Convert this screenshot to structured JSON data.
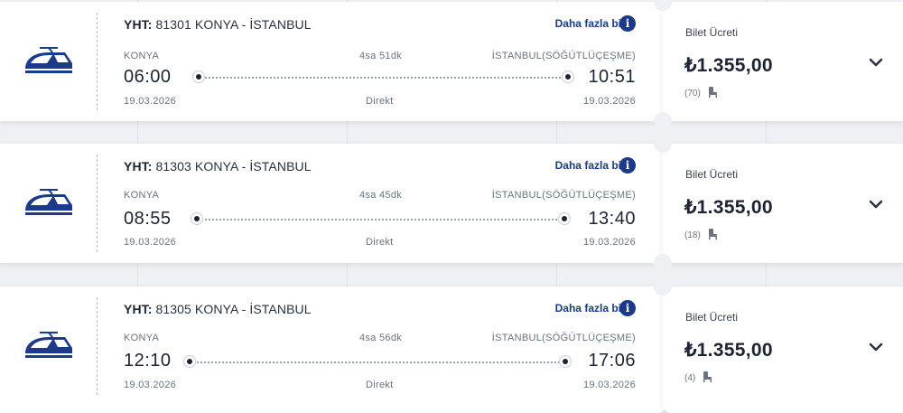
{
  "trips": [
    {
      "title_code": "YHT:",
      "title_route": "81301 KONYA - İSTANBUL",
      "info_link": "Daha fazla bilgi",
      "from_station": "KONYA",
      "to_station": "İSTANBUL(SÖĞÜTLÜÇEŞME)",
      "duration": "4sa 51dk",
      "depart_time": "06:00",
      "arrive_time": "10:51",
      "depart_date": "19.03.2026",
      "arrive_date": "19.03.2026",
      "connection": "Direkt",
      "price_label": "Bilet Ücreti",
      "price": "₺1.355,00",
      "seats": "(70)"
    },
    {
      "title_code": "YHT:",
      "title_route": "81303 KONYA - İSTANBUL",
      "info_link": "Daha fazla bilgi",
      "from_station": "KONYA",
      "to_station": "İSTANBUL(SÖĞÜTLÜÇEŞME)",
      "duration": "4sa 45dk",
      "depart_time": "08:55",
      "arrive_time": "13:40",
      "depart_date": "19.03.2026",
      "arrive_date": "19.03.2026",
      "connection": "Direkt",
      "price_label": "Bilet Ücreti",
      "price": "₺1.355,00",
      "seats": "(18)"
    },
    {
      "title_code": "YHT:",
      "title_route": "81305 KONYA - İSTANBUL",
      "info_link": "Daha fazla bilgi",
      "from_station": "KONYA",
      "to_station": "İSTANBUL(SÖĞÜTLÜÇEŞME)",
      "duration": "4sa 56dk",
      "depart_time": "12:10",
      "arrive_time": "17:06",
      "depart_date": "19.03.2026",
      "arrive_date": "19.03.2026",
      "connection": "Direkt",
      "price_label": "Bilet Ücreti",
      "price": "₺1.355,00",
      "seats": "(4)"
    }
  ],
  "icons": {
    "train": "train-icon",
    "info": "info-icon",
    "seat": "seat-icon",
    "expand": "chevron-down-icon"
  },
  "colors": {
    "brand": "#1b3a8c",
    "background": "#eef0f4",
    "text": "#1d2333"
  }
}
